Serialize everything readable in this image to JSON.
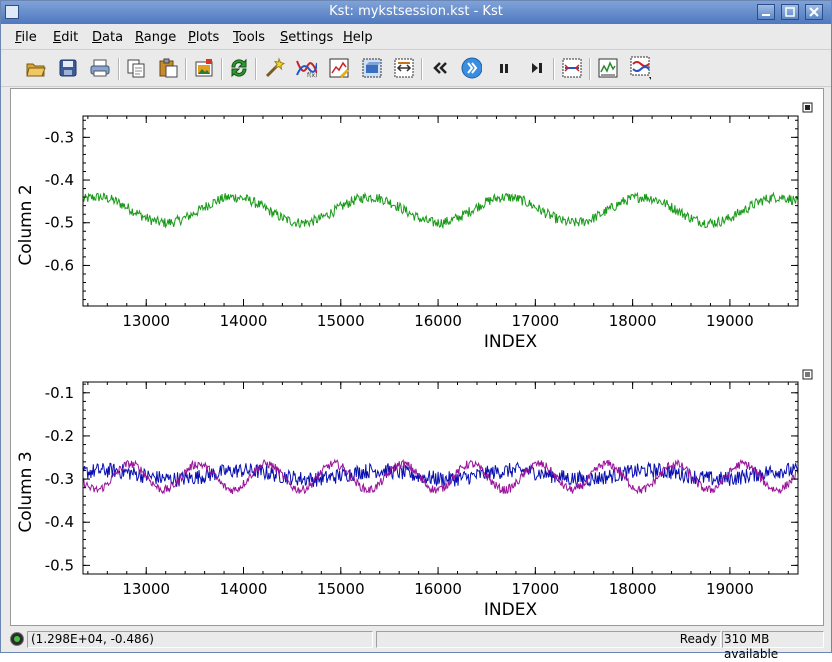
{
  "window": {
    "title": "Kst: mykstsession.kst - Kst",
    "controls": [
      "minimize",
      "maximize",
      "close"
    ]
  },
  "menubar": {
    "items": [
      {
        "label": "File",
        "key": "F"
      },
      {
        "label": "Edit",
        "key": "E"
      },
      {
        "label": "Data",
        "key": "D"
      },
      {
        "label": "Range",
        "key": "R"
      },
      {
        "label": "Plots",
        "key": "P"
      },
      {
        "label": "Tools",
        "key": "T"
      },
      {
        "label": "Settings",
        "key": "S"
      },
      {
        "label": "Help",
        "key": "H"
      }
    ]
  },
  "toolbar": {
    "buttons": [
      "open-icon",
      "save-icon",
      "print-icon",
      "copy-icon",
      "paste-icon",
      "export-image-icon",
      "reload-icon",
      "data-wizard-icon",
      "curve-icon",
      "plot-dialog-icon",
      "data-manager-icon",
      "view-manager-icon",
      "back-icon",
      "play-icon",
      "pause-icon",
      "advance-icon",
      "zoom-mode-icon",
      "layout-icon",
      "graphics-mode-icon"
    ]
  },
  "chart_data": [
    {
      "type": "line",
      "title": "",
      "xlabel": "INDEX",
      "ylabel": "Column 2",
      "xlim": [
        12350,
        19700
      ],
      "ylim": [
        -0.695,
        -0.25
      ],
      "xticks": [
        "13000",
        "14000",
        "15000",
        "16000",
        "17000",
        "18000",
        "19000"
      ],
      "yticks": [
        "-0.3",
        "-0.4",
        "-0.5",
        "-0.6"
      ],
      "series": [
        {
          "color": "#1a9a1a",
          "mean": -0.47,
          "amplitude": 0.03,
          "period": 1400,
          "phase": 0.9,
          "noise": 0.012
        }
      ]
    },
    {
      "type": "line",
      "title": "",
      "xlabel": "INDEX",
      "ylabel": "Column 3",
      "xlim": [
        12350,
        19700
      ],
      "ylim": [
        -0.52,
        -0.075
      ],
      "xticks": [
        "13000",
        "14000",
        "15000",
        "16000",
        "17000",
        "18000",
        "19000"
      ],
      "yticks": [
        "-0.1",
        "-0.2",
        "-0.3",
        "-0.4",
        "-0.5"
      ],
      "series": [
        {
          "color": "#0a10b0",
          "mean": -0.29,
          "amplitude": 0.01,
          "period": 1400,
          "phase": 0.5,
          "noise": 0.018
        },
        {
          "color": "#9a149a",
          "mean": -0.295,
          "amplitude": 0.03,
          "period": 700,
          "phase": 3.5,
          "noise": 0.01
        }
      ]
    }
  ],
  "statusbar": {
    "coords": "(1.298E+04, -0.486)",
    "state": "Ready",
    "memory": "310 MB available"
  }
}
